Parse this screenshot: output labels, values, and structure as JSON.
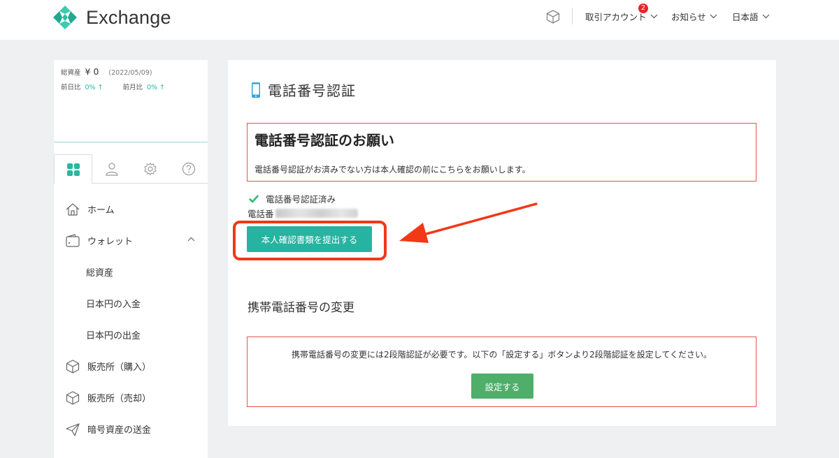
{
  "header": {
    "brand": "Exchange",
    "nav": {
      "trading_account": "取引アカウント",
      "notification_badge": "2",
      "news": "お知らせ",
      "language": "日本語"
    },
    "icons": {
      "box": "cube-icon"
    }
  },
  "sidebar": {
    "assets": {
      "label": "総資産",
      "value": "¥ 0",
      "date": "(2022/05/09)",
      "prev_day_label": "前日比",
      "prev_day_value": "0% ↑",
      "prev_month_label": "前月比",
      "prev_month_value": "0% ↑"
    },
    "tabs": [
      "grid-icon",
      "user-icon",
      "gear-icon",
      "help-icon"
    ],
    "menu": [
      {
        "label": "ホーム",
        "icon": "home-icon"
      },
      {
        "label": "ウォレット",
        "icon": "wallet-icon",
        "expanded": true
      },
      {
        "label": "総資産"
      },
      {
        "label": "日本円の入金"
      },
      {
        "label": "日本円の出金"
      },
      {
        "label": "販売所（購入）",
        "icon": "cube-icon"
      },
      {
        "label": "販売所（売却）",
        "icon": "cube-icon"
      },
      {
        "label": "暗号資産の送金",
        "icon": "send-icon"
      }
    ]
  },
  "main": {
    "title": "電話番号認証",
    "notice": {
      "heading": "電話番号認証のお願い",
      "text": "電話番号認証がお済みでない方は本人確認の前にこちらをお願いします。"
    },
    "status": "電話番号認証済み",
    "phone_label": "電話番",
    "submit_button": "本人確認書類を提出する",
    "change_section": {
      "title": "携帯電話番号の変更",
      "text": "携帯電話番号の変更には2段階認証が必要です。以下の「設定する」ボタンより2段階認証を設定してください。",
      "button": "設定する"
    }
  },
  "colors": {
    "accent": "#27b3a1",
    "set_button": "#4fae6a",
    "highlight": "#f23816",
    "notice_border": "#e0554a",
    "badge": "#e8262b"
  }
}
